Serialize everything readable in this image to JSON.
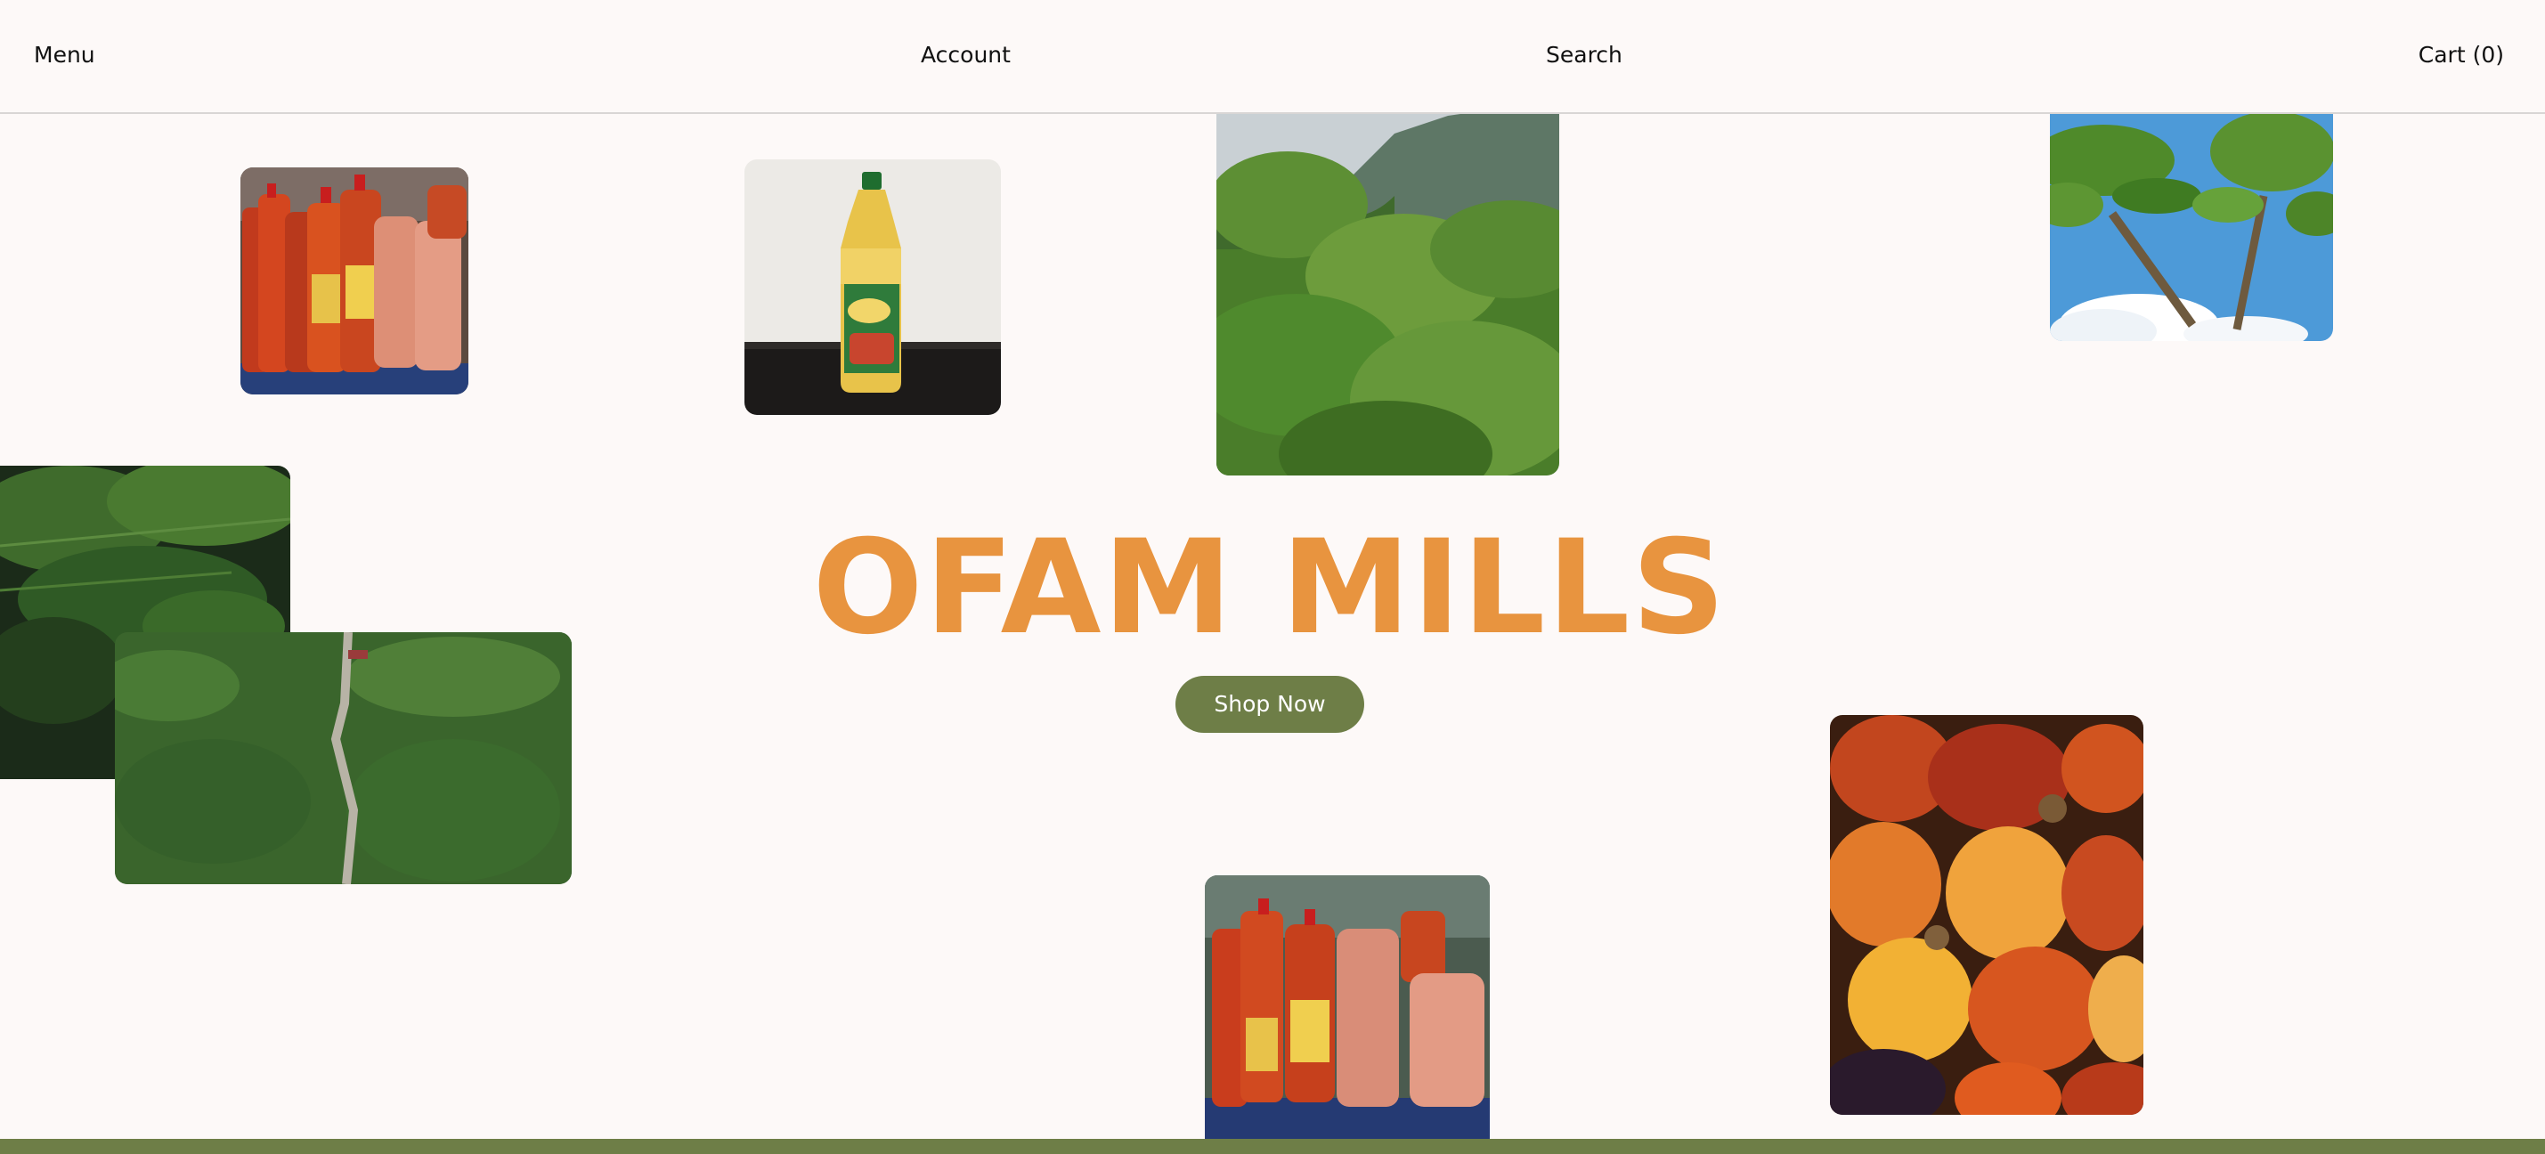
{
  "header": {
    "menu_label": "Menu",
    "account_label": "Account",
    "search_label": "Search",
    "cart_label": "Cart (0)"
  },
  "hero": {
    "title": "OFAM MILLS",
    "cta_label": "Shop Now"
  },
  "colors": {
    "background": "#fdf9f8",
    "brand_orange": "#e8943f",
    "brand_green": "#6e7e47",
    "header_border": "#d9d6d5"
  },
  "images": [
    {
      "name": "red-palm-oil-bottles-image"
    },
    {
      "name": "cooking-oil-bottle-image"
    },
    {
      "name": "palm-forest-mountain-image"
    },
    {
      "name": "palm-trees-sky-image"
    },
    {
      "name": "tropical-leaves-image"
    },
    {
      "name": "palm-plantation-aerial-image"
    },
    {
      "name": "red-palm-oil-bottles-market-image"
    },
    {
      "name": "palm-fruits-closeup-image"
    }
  ]
}
